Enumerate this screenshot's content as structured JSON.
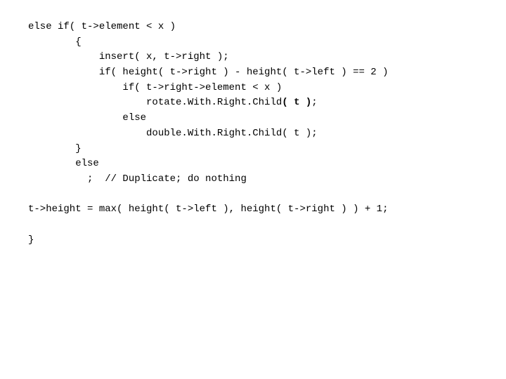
{
  "code": {
    "l01": "else if( t->element < x )",
    "l02": "        {",
    "l03": "            insert( x, t->right );",
    "l04": "            if( height( t->right ) - height( t->left ) == 2 )",
    "l05": "                if( t->right->element < x )",
    "l06a": "                    rotate.With.Right.Child",
    "l06b": "( t )",
    "l06c": ";",
    "l07": "                else",
    "l08": "                    double.With.Right.Child( t );",
    "l09": "        }",
    "l10": "        else",
    "l11": "          ;  // Duplicate; do nothing",
    "l12": "t->height = max( height( t->left ), height( t->right ) ) + 1;",
    "l13": "}"
  }
}
